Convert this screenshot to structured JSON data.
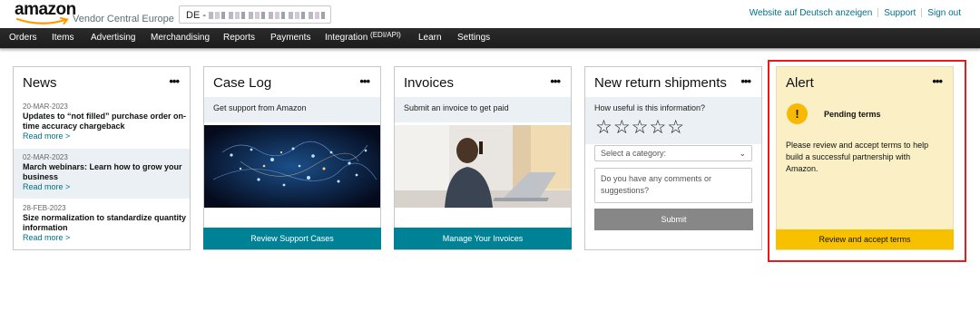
{
  "header": {
    "logo_word": "amazon",
    "logo_sub": "Vendor Central Europe",
    "account_prefix": "DE -",
    "links": [
      "Website auf Deutsch anzeigen",
      "Support",
      "Sign out"
    ]
  },
  "nav": {
    "items": [
      "Orders",
      "Items",
      "Advertising",
      "Merchandising",
      "Reports",
      "Payments",
      "Integration",
      "Learn",
      "Settings"
    ],
    "integration_sup": "(EDI/API)"
  },
  "news": {
    "title": "News",
    "items": [
      {
        "date": "20-MAR-2023",
        "headline": "Updates to “not filled” purchase order on-time accuracy chargeback",
        "more": "Read more >"
      },
      {
        "date": "02-MAR-2023",
        "headline": "March webinars: Learn how to grow your business",
        "more": "Read more >"
      },
      {
        "date": "28-FEB-2023",
        "headline": "Size normalization to standardize quantity information",
        "more": "Read more >"
      }
    ]
  },
  "caselog": {
    "title": "Case Log",
    "band": "Get support from Amazon",
    "button": "Review Support Cases"
  },
  "invoices": {
    "title": "Invoices",
    "band": "Submit an invoice to get paid",
    "button": "Manage Your Invoices"
  },
  "returns": {
    "title": "New return shipments",
    "question": "How useful is this information?",
    "stars": "☆☆☆☆☆",
    "category_placeholder": "Select a category:",
    "comments_placeholder": "Do you have any comments or suggestions?",
    "submit": "Submit"
  },
  "alert": {
    "title": "Alert",
    "icon": "!",
    "heading": "Pending terms",
    "text": "Please review and accept terms to help build a successful partnership with Amazon.",
    "button": "Review and accept terms"
  },
  "colors": {
    "nav_bg": "#232f3e",
    "teal": "#008296",
    "alert_bg": "#fbf0c5",
    "alert_button": "#f8c100",
    "highlight": "#e31c1c"
  }
}
